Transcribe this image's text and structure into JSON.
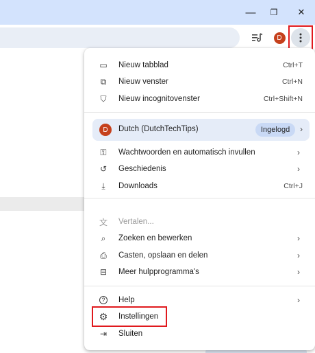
{
  "window": {
    "minimize_glyph": "—",
    "restore_glyph": "❐",
    "close_glyph": "✕"
  },
  "toolbar": {
    "reading_list_icon": "reading-list-icon",
    "avatar_letter": "D",
    "menu_icon": "three-dot-menu-icon"
  },
  "menu": {
    "items_top": [
      {
        "label": "Nieuw tabblad",
        "shortcut": "Ctrl+T",
        "icon": "new-tab-icon",
        "glyph": "▭"
      },
      {
        "label": "Nieuw venster",
        "shortcut": "Ctrl+N",
        "icon": "new-window-icon",
        "glyph": "⧉"
      },
      {
        "label": "Nieuw incognitovenster",
        "shortcut": "Ctrl+Shift+N",
        "icon": "incognito-icon",
        "glyph": "⛉"
      }
    ],
    "profile": {
      "avatar_letter": "D",
      "name": "Dutch (DutchTechTips)",
      "badge": "Ingelogd",
      "chevron": "›"
    },
    "items_mid": [
      {
        "label": "Wachtwoorden en automatisch invullen",
        "chevron": "›",
        "icon": "key-icon",
        "glyph": "⚿"
      },
      {
        "label": "Geschiedenis",
        "chevron": "›",
        "icon": "history-icon",
        "glyph": "↺"
      },
      {
        "label": "Downloads",
        "shortcut": "Ctrl+J",
        "icon": "download-icon",
        "glyph": "⤓"
      }
    ],
    "items_tools": [
      {
        "label": "Vertalen...",
        "icon": "translate-icon",
        "glyph": "文"
      },
      {
        "label": "Zoeken en bewerken",
        "chevron": "›",
        "icon": "find-icon",
        "glyph": "⌕"
      },
      {
        "label": "Casten, opslaan en delen",
        "chevron": "›",
        "icon": "cast-icon",
        "glyph": "⎙"
      },
      {
        "label": "Meer hulpprogramma's",
        "chevron": "›",
        "icon": "toolbox-icon",
        "glyph": "⊟"
      }
    ],
    "items_bottom": [
      {
        "label": "Help",
        "chevron": "›",
        "icon": "help-icon",
        "glyph": "?"
      },
      {
        "label": "Instellingen",
        "icon": "gear-icon",
        "glyph": "⚙"
      },
      {
        "label": "Sluiten",
        "icon": "exit-icon",
        "glyph": "⇥"
      }
    ]
  }
}
